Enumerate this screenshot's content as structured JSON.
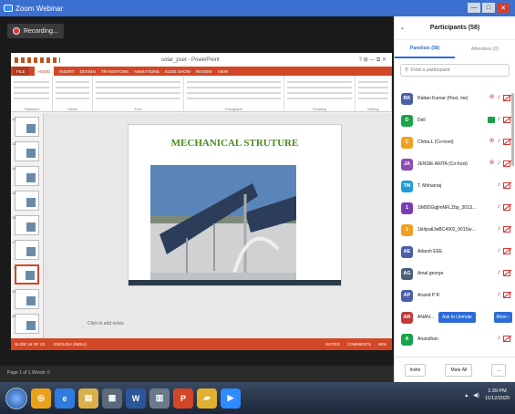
{
  "window": {
    "title": "Zoom Webinar",
    "controls": [
      "—",
      "□",
      "✕"
    ]
  },
  "recording": {
    "label": "Recording..."
  },
  "powerpoint": {
    "title": "solar_pset - PowerPoint",
    "top_right": "? ⊞ — ⧉ ✕",
    "sign_in": "Sign in",
    "tabs": [
      "FILE",
      "HOME",
      "INSERT",
      "DESIGN",
      "TRANSITIONS",
      "ANIMATIONS",
      "SLIDE SHOW",
      "REVIEW",
      "VIEW"
    ],
    "ribbon_groups": [
      "Clipboard",
      "Slides",
      "Font",
      "Paragraph",
      "Drawing",
      "Editing"
    ],
    "slide_title": "MECHANICAL STRUTURE",
    "notes_placeholder": "Click to add notes",
    "status_left": "SLIDE 18 OF 23",
    "status_lang": "ENGLISH (INDIA)",
    "status_notes": "NOTES",
    "status_comments": "COMMENTS",
    "zoom": "60%",
    "thumbnails": [
      {
        "num": "12"
      },
      {
        "num": "13"
      },
      {
        "num": "14"
      },
      {
        "num": "15"
      },
      {
        "num": "16"
      },
      {
        "num": "17"
      },
      {
        "num": "18"
      },
      {
        "num": "19"
      },
      {
        "num": "20"
      }
    ]
  },
  "bottom_strip": "Page 1 of 1   Words: 0",
  "participants": {
    "header": "Participants (58)",
    "tab_panelists": "Panelists (58)",
    "tab_attendees": "Attendees (0)",
    "search_placeholder": "Find a participant",
    "list": [
      {
        "initials": "RK",
        "name": "Rattan Kumar (Host, me)",
        "color": "#4a5fa8"
      },
      {
        "initials": "D",
        "name": "Dell",
        "color": "#1aa34a"
      },
      {
        "initials": "C",
        "name": "Chitra.L (Co-host)",
        "color": "#f0a020"
      },
      {
        "initials": "JA",
        "name": "JENSIE ANITA (Co-host)",
        "color": "#8e4bb5"
      },
      {
        "initials": "TM",
        "name": "T. Mohanraj",
        "color": "#1f9bd8"
      },
      {
        "initials": "1",
        "name": "1iM9DGqjlmNFLZbp_301SwKg...",
        "color": "#7a3cb5"
      },
      {
        "initials": "1",
        "name": "1kl4patlJwBC4902_901SwKgn4...",
        "color": "#f0a020"
      },
      {
        "initials": "AE",
        "name": "Adarsh EEE",
        "color": "#4a5fa8"
      },
      {
        "initials": "AG",
        "name": "Amal george",
        "color": "#4a6078"
      },
      {
        "initials": "AP",
        "name": "Anand P R",
        "color": "#4a5fa8"
      },
      {
        "initials": "AR",
        "name": "ANAN...",
        "color": "#c03a3a"
      },
      {
        "initials": "A",
        "name": "Anandhan",
        "color": "#1aa34a"
      }
    ],
    "unmute_label": "Ask to Unmute",
    "more_label": "More ›",
    "invite_label": "Invite",
    "mute_all_label": "Mute All",
    "dots_label": "..."
  },
  "taskbar": {
    "time": "1:39 PM",
    "date": "11/12/2020",
    "apps": [
      "IE",
      "Files",
      "Word",
      "Calc",
      "PPT",
      "Folder",
      "Zoom"
    ]
  }
}
